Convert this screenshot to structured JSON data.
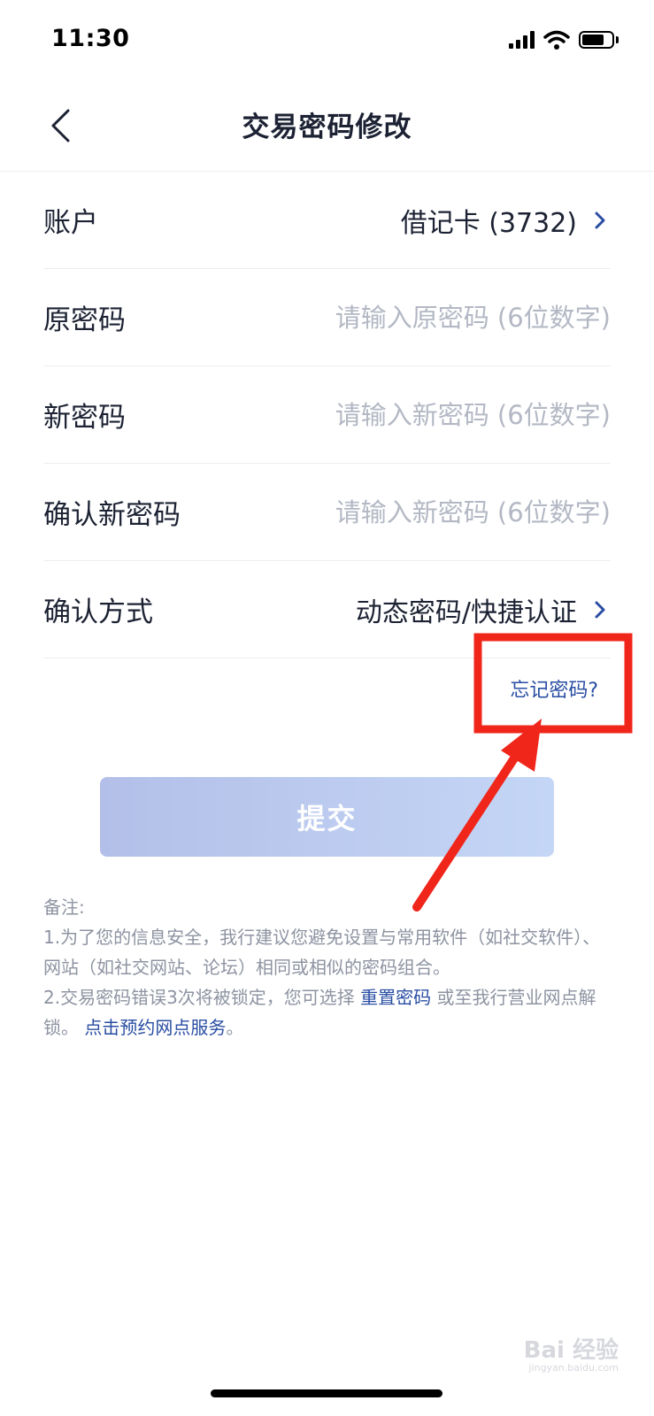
{
  "status_bar": {
    "time": "11:30"
  },
  "nav": {
    "title": "交易密码修改",
    "back_icon": "chevron-left-icon"
  },
  "form": {
    "account": {
      "label": "账户",
      "value": "借记卡 (3732)"
    },
    "old_password": {
      "label": "原密码",
      "placeholder": "请输入原密码 (6位数字)",
      "value": ""
    },
    "new_password": {
      "label": "新密码",
      "placeholder": "请输入新密码 (6位数字)",
      "value": ""
    },
    "confirm_password": {
      "label": "确认新密码",
      "placeholder": "请输入新密码 (6位数字)",
      "value": ""
    },
    "verify_method": {
      "label": "确认方式",
      "value": "动态密码/快捷认证"
    },
    "forgot_link": "忘记密码?"
  },
  "submit": {
    "label": "提交"
  },
  "notes": {
    "title": "备注:",
    "line1": "1.为了您的信息安全，我行建议您避免设置与常用软件（如社交软件）、网站（如社交网站、论坛）相同或相似的密码组合。",
    "line2_prefix": "2.交易密码错误3次将被锁定，您可选择 ",
    "reset_link": "重置密码",
    "line2_middle": " 或至我行营业网点解锁。 ",
    "appointment_link": "点击预约网点服务",
    "line2_suffix": "。"
  },
  "watermark": {
    "text": "Bai 经验",
    "sub": "jingyan.baidu.com"
  },
  "colors": {
    "accent": "#2a4ea3",
    "text": "#1c2233",
    "placeholder": "#b3b8c4",
    "note": "#8d93a1",
    "annotation": "#f0261b"
  }
}
